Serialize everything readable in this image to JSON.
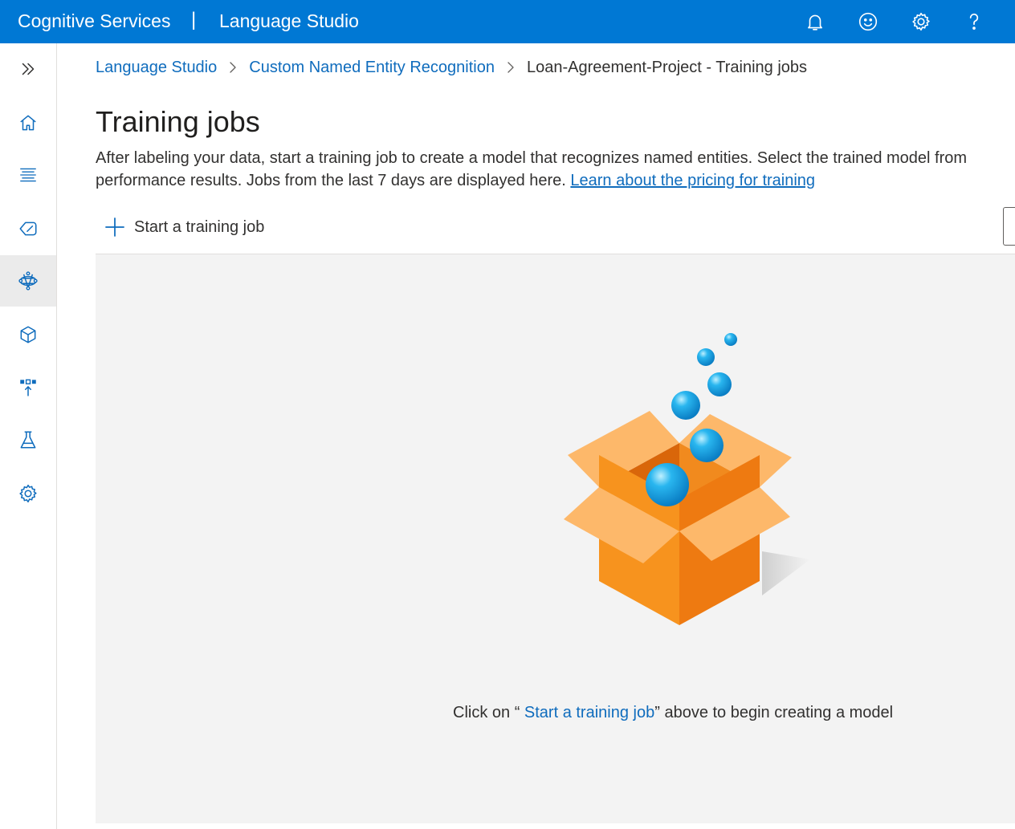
{
  "topbar": {
    "brand": "Cognitive Services",
    "separator": "|",
    "product": "Language Studio",
    "icons": [
      "bell-icon",
      "smiley-icon",
      "gear-icon",
      "help-icon"
    ]
  },
  "leftnav": {
    "items": [
      {
        "name": "expand",
        "icon": "chevron-double-right-icon"
      },
      {
        "name": "home",
        "icon": "home-icon"
      },
      {
        "name": "data-labeling",
        "icon": "text-lines-icon"
      },
      {
        "name": "tags",
        "icon": "tag-icon"
      },
      {
        "name": "training-jobs",
        "icon": "model-network-icon",
        "active": true
      },
      {
        "name": "models",
        "icon": "cube-icon"
      },
      {
        "name": "deploy",
        "icon": "deploy-icon"
      },
      {
        "name": "test",
        "icon": "flask-icon"
      },
      {
        "name": "settings",
        "icon": "gear-icon"
      }
    ]
  },
  "breadcrumb": {
    "items": [
      "Language Studio",
      "Custom Named Entity Recognition",
      "Loan-Agreement-Project - Training jobs"
    ]
  },
  "page": {
    "title": "Training jobs",
    "description_line1": "After labeling your data, start a training job to create a model that recognizes named entities. Select the trained model from",
    "description_line2": "performance results. Jobs from the last 7 days are displayed here. ",
    "pricing_link": "Learn about the pricing for training"
  },
  "command_bar": {
    "start_label": "Start a training job"
  },
  "empty_state": {
    "prefix": "Click on “ ",
    "link": "Start a training job",
    "suffix": "” above to begin creating a model"
  },
  "colors": {
    "accent": "#0078d4",
    "link": "#0f6cbd",
    "panel": "#f3f3f3",
    "box_orange": "#f7931e",
    "bubble_blue": "#1ba1e2"
  }
}
